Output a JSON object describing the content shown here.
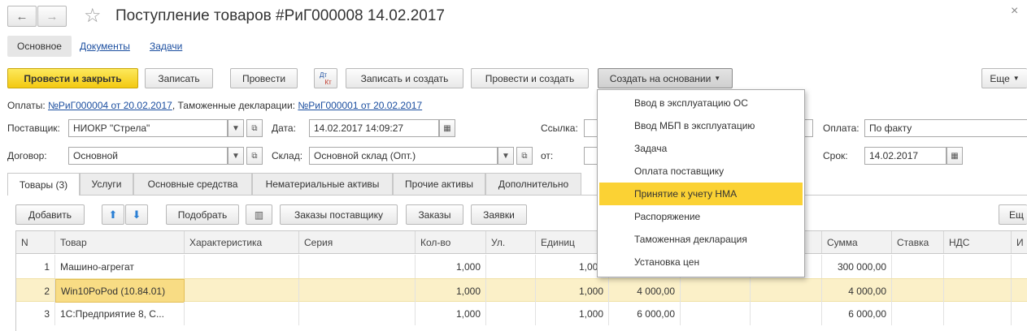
{
  "window": {
    "title": "Поступление товаров #РиГ000008 14.02.2017",
    "close_glyph": "×",
    "back_glyph": "←",
    "forward_glyph": "→",
    "star_glyph": "☆"
  },
  "nav_tabs": [
    "Основное",
    "Документы",
    "Задачи"
  ],
  "toolbar": {
    "post_close": "Провести и закрыть",
    "save": "Записать",
    "post": "Провести",
    "dtkt_dt": "Дт",
    "dtkt_kt": "Кт",
    "save_create": "Записать и создать",
    "post_create": "Провести и создать",
    "create_based": "Создать на основании",
    "more": "Еще"
  },
  "info_line": {
    "payments_label": "Оплаты:",
    "payments_link": "№РиГ000004 от 20.02.2017",
    "customs_label": ", Таможенные декларации:",
    "customs_link": "№РиГ000001 от 20.02.2017"
  },
  "form": {
    "supplier_label": "Поставщик:",
    "supplier_value": "НИОКР \"Стрела\"",
    "contract_label": "Договор:",
    "contract_value": "Основной",
    "date_label": "Дата:",
    "date_value": "14.02.2017 14:09:27",
    "warehouse_label": "Склад:",
    "warehouse_value": "Основной склад (Опт.)",
    "link_label": "Ссылка:",
    "from_label": "от:",
    "payment_label": "Оплата:",
    "payment_value": "По факту",
    "term_label": "Срок:",
    "term_value": "14.02.2017"
  },
  "content_tabs": [
    "Товары (3)",
    "Услуги",
    "Основные средства",
    "Нематериальные активы",
    "Прочие активы",
    "Дополнительно"
  ],
  "table_toolbar": {
    "add": "Добавить",
    "select": "Подобрать",
    "supplier_orders": "Заказы поставщику",
    "orders": "Заказы",
    "requests": "Заявки",
    "more": "Ещ"
  },
  "table": {
    "columns": [
      "N",
      "Товар",
      "Характеристика",
      "Серия",
      "Кол-во",
      "Ул.",
      "Единиц",
      "",
      "",
      "",
      "Сумма",
      "Ставка",
      "НДС",
      "И"
    ],
    "rows": [
      {
        "n": "1",
        "item": "Машино-агрегат",
        "qty": "1,000",
        "units": "1,000",
        "price": "",
        "sum": "300 000,00"
      },
      {
        "n": "2",
        "item": "Win10PoPod (10.84.01)",
        "qty": "1,000",
        "units": "1,000",
        "price": "4 000,00",
        "sum": "4 000,00"
      },
      {
        "n": "3",
        "item": "1С:Предприятие 8, С...",
        "qty": "1,000",
        "units": "1,000",
        "price": "6 000,00",
        "sum": "6 000,00"
      }
    ]
  },
  "dropdown_menu": {
    "items": [
      "Ввод в эксплуатацию ОС",
      "Ввод МБП в эксплуатацию",
      "Задача",
      "Оплата поставщику",
      "Принятие к учету НМА",
      "Распоряжение",
      "Таможенная декларация",
      "Установка цен"
    ],
    "selected_index": 4
  },
  "colors": {
    "accent_yellow": "#f5cd1d",
    "selected_row": "#fbf0c8",
    "link": "#1c4fa0"
  }
}
